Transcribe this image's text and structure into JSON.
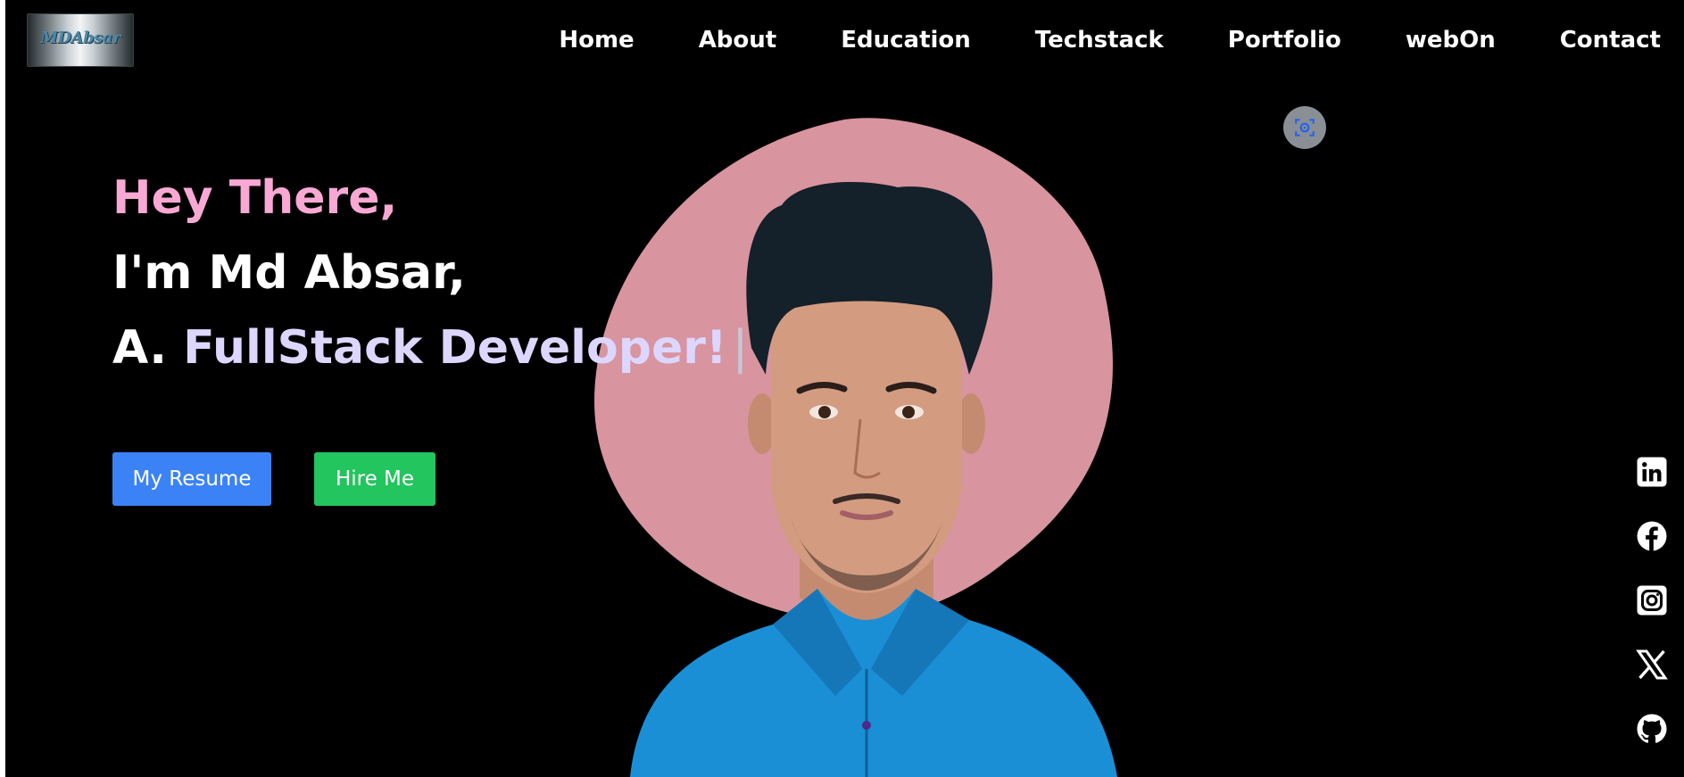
{
  "logo": {
    "text": "MDAbsar"
  },
  "nav": {
    "items": [
      {
        "label": "Home"
      },
      {
        "label": "About"
      },
      {
        "label": "Education"
      },
      {
        "label": "Techstack"
      },
      {
        "label": "Portfolio"
      },
      {
        "label": "webOn"
      },
      {
        "label": "Contact"
      }
    ]
  },
  "hero": {
    "greeting": "Hey There,",
    "intro": "I'm Md Absar,",
    "role_prefix": "A.",
    "role": "FullStack Developer!",
    "cursor": "|"
  },
  "buttons": {
    "resume": "My Resume",
    "hire": "Hire Me"
  },
  "floating": {
    "icon": "screen-capture-icon"
  },
  "social": [
    {
      "icon": "linkedin-icon"
    },
    {
      "icon": "facebook-icon"
    },
    {
      "icon": "instagram-icon"
    },
    {
      "icon": "x-twitter-icon"
    },
    {
      "icon": "github-icon"
    }
  ],
  "colors": {
    "background": "#000000",
    "greeting": "#f9a8d4",
    "role": "#ddd6fe",
    "resume_button": "#3b82f6",
    "hire_button": "#22c55e",
    "blob": "#d8949f",
    "shirt": "#1a8fd6"
  }
}
